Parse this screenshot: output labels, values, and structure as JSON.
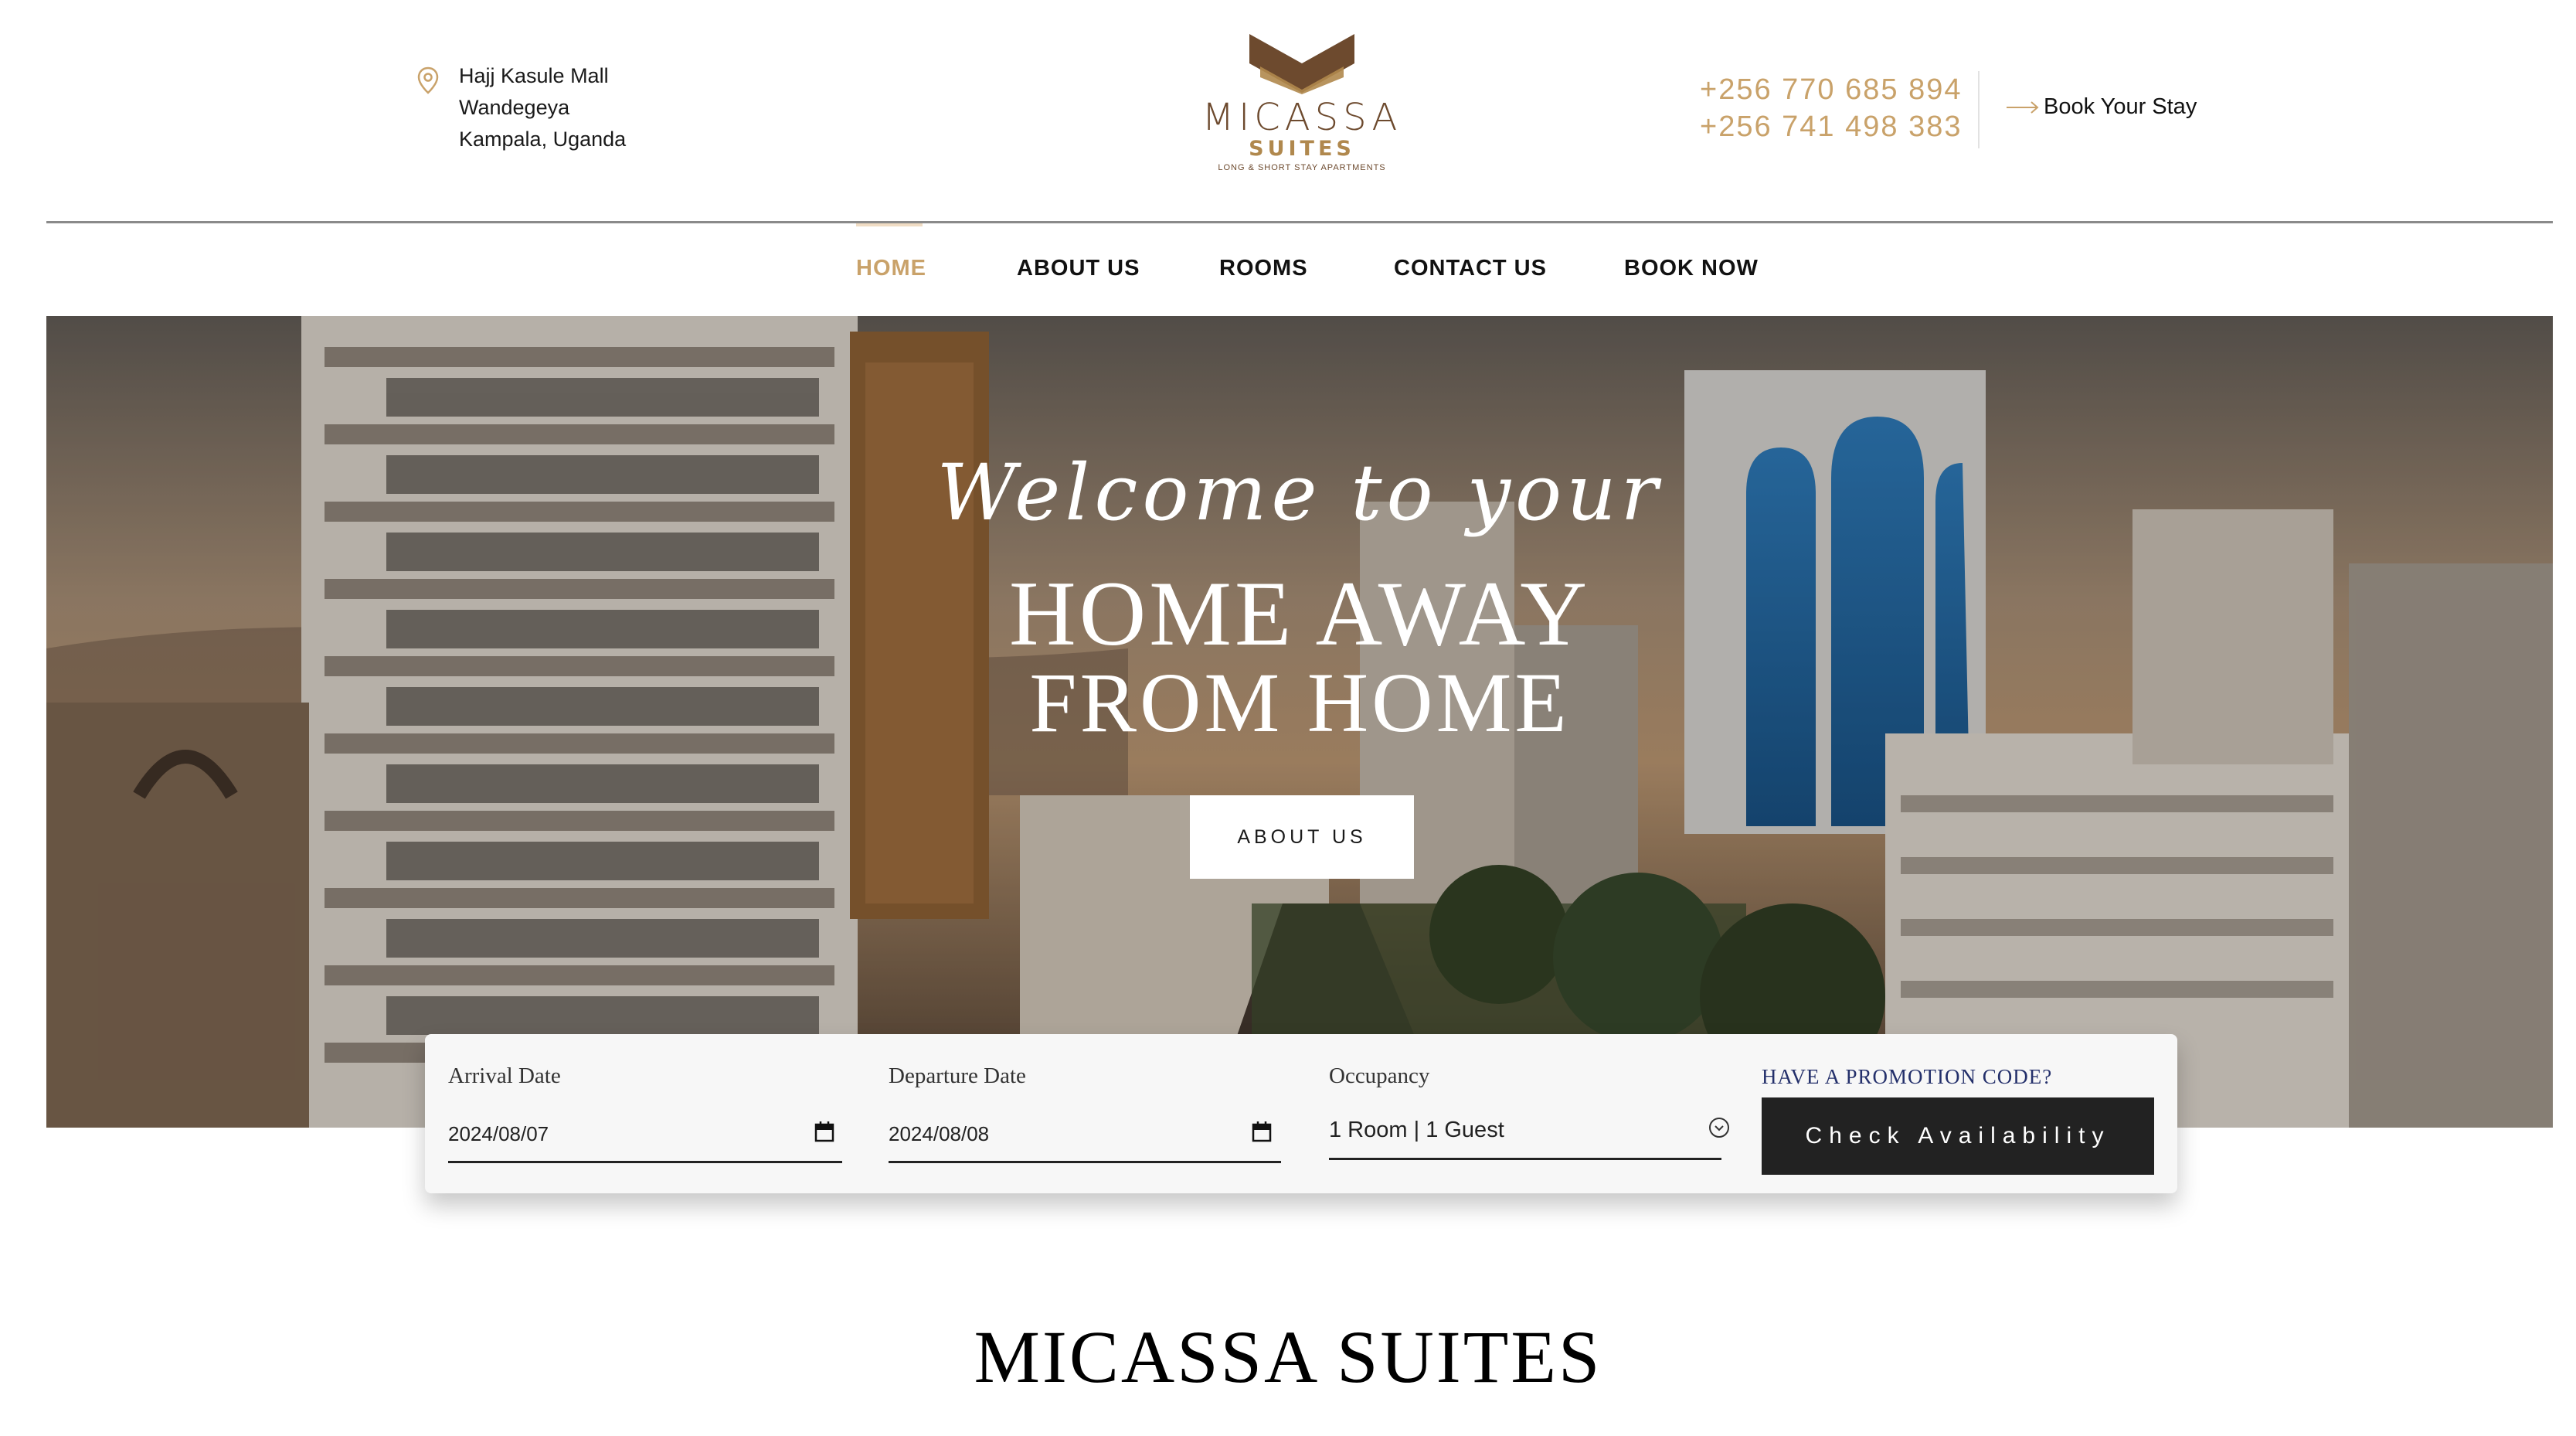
{
  "header": {
    "address": [
      "Hajj Kasule Mall",
      "Wandegeya",
      "Kampala, Uganda"
    ],
    "logo": {
      "name": "MICASSA",
      "sub": "SUITES",
      "tagline": "LONG & SHORT STAY APARTMENTS"
    },
    "phones": [
      "+256 770 685 894",
      "+256 741 498 383"
    ],
    "book_stay": "Book Your Stay"
  },
  "nav": {
    "items": [
      {
        "label": "HOME",
        "active": true
      },
      {
        "label": "ABOUT US",
        "active": false
      },
      {
        "label": "ROOMS",
        "active": false
      },
      {
        "label": "CONTACT US",
        "active": false
      },
      {
        "label": "BOOK NOW",
        "active": false
      }
    ]
  },
  "hero": {
    "welcome": "Welcome to your",
    "title_line1": "HOME AWAY",
    "title_line2": "FROM HOME",
    "button": "ABOUT US"
  },
  "booking": {
    "arrival_label": "Arrival Date",
    "arrival_value": "2024/08/07",
    "departure_label": "Departure Date",
    "departure_value": "2024/08/08",
    "occupancy_label": "Occupancy",
    "occupancy_value": "1 Room | 1 Guest",
    "promo": "HAVE A PROMOTION CODE?",
    "check_button": "Check Availability"
  },
  "section": {
    "title": "MICASSA SUITES"
  },
  "colors": {
    "accent": "#c9a26a",
    "brand_brown": "#6d4a2e",
    "promo_navy": "#24306b",
    "dark_button": "#222222"
  }
}
